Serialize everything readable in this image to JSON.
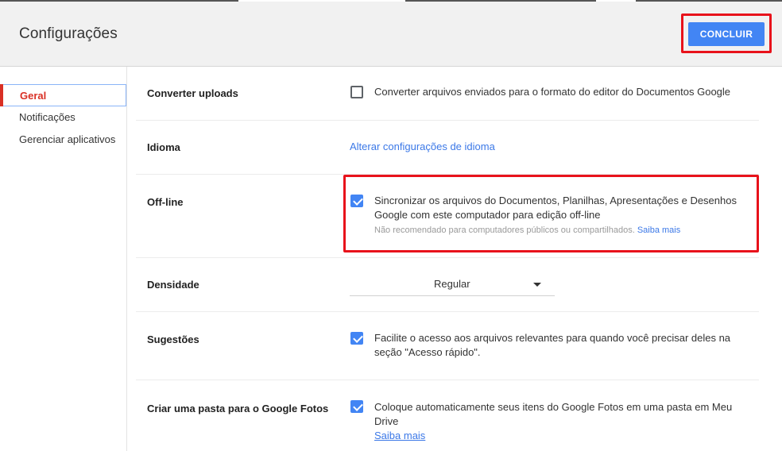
{
  "header": {
    "title": "Configurações",
    "done_label": "CONCLUIR"
  },
  "sidebar": {
    "items": [
      {
        "label": "Geral"
      },
      {
        "label": "Notificações"
      },
      {
        "label": "Gerenciar aplicativos"
      }
    ]
  },
  "settings": {
    "converter": {
      "label": "Converter uploads",
      "checkbox_text": "Converter arquivos enviados para o formato do editor do Documentos Google",
      "checked": false
    },
    "idioma": {
      "label": "Idioma",
      "link": "Alterar configurações de idioma"
    },
    "offline": {
      "label": "Off-line",
      "text_line1": "Sincronizar os arquivos do Documentos, Planilhas, Apresentações e Desenhos",
      "text_line2": "Google com este computador para edição off-line",
      "note": "Não recomendado para computadores públicos ou compartilhados.",
      "note_link": "Saiba mais",
      "checked": true
    },
    "densidade": {
      "label": "Densidade",
      "selected": "Regular"
    },
    "sugestoes": {
      "label": "Sugestões",
      "text_line1": "Facilite o acesso aos arquivos relevantes para quando você precisar deles na",
      "text_line2": "seção \"Acesso rápido\".",
      "checked": true
    },
    "fotos": {
      "label": "Criar uma pasta para o Google Fotos",
      "text_line1": "Coloque automaticamente seus itens do Google Fotos em uma pasta em Meu",
      "text_line2": "Drive",
      "link": "Saiba mais",
      "checked": true
    }
  },
  "colors": {
    "accent": "#4285f4",
    "highlight": "#e8121b",
    "active_nav": "#d93025",
    "link": "#3b78e7"
  }
}
